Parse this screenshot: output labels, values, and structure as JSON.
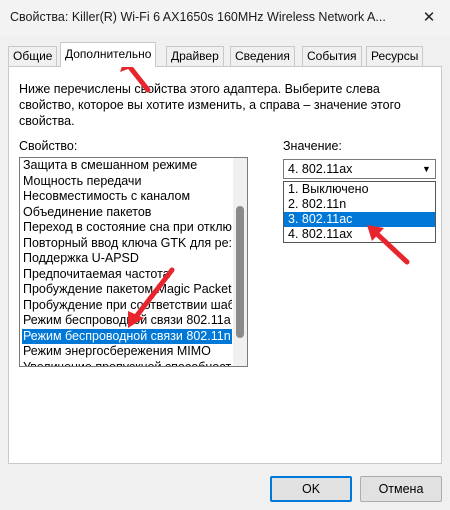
{
  "window": {
    "title": "Свойства: Killer(R) Wi-Fi 6 AX1650s 160MHz Wireless Network A...",
    "close_symbol": "✕"
  },
  "tabs": [
    {
      "label": "Общие",
      "active": false
    },
    {
      "label": "Дополнительно",
      "active": true
    },
    {
      "label": "Драйвер",
      "active": false
    },
    {
      "label": "Сведения",
      "active": false
    },
    {
      "label": "События",
      "active": false
    },
    {
      "label": "Ресурсы",
      "active": false
    }
  ],
  "description": "Ниже перечислены свойства этого адаптера. Выберите слева свойство, которое вы хотите изменить, а справа – значение этого свойства.",
  "property": {
    "label": "Свойство:",
    "items": [
      "Защита в смешанном режиме",
      "Мощность передачи",
      "Несовместимость с каналом",
      "Объединение пакетов",
      "Переход в состояние сна при отклю",
      "Повторный ввод ключа GTK для ре:",
      "Поддержка U-APSD",
      "Предпочитаемая частота",
      "Пробуждение пакетом Magic Packet",
      "Пробуждение при соответствии шаб",
      "Режим беспроводной связи 802.11а",
      "Режим беспроводной связи 802.11n",
      "Режим энергосбережения MIMO",
      "Увеличение пропускной способност"
    ],
    "selected_index": 11
  },
  "value": {
    "label": "Значение:",
    "current": "4. 802.11ax",
    "options": [
      "1. Выключено",
      "2. 802.11n",
      "3. 802.11ac",
      "4. 802.11ax"
    ],
    "highlighted_index": 2,
    "arrow_symbol": "▼"
  },
  "buttons": {
    "ok": "OK",
    "cancel": "Отмена"
  },
  "colors": {
    "selection": "#0078d7",
    "annotation_arrow": "#e8242c"
  }
}
